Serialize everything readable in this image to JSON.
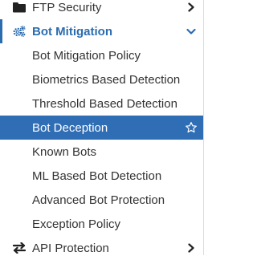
{
  "nav": {
    "ftp_security": {
      "label": "FTP Security",
      "icon": "folder-icon"
    },
    "bot_mitigation": {
      "label": "Bot Mitigation",
      "icon": "gears-icon",
      "items": [
        {
          "label": "Bot Mitigation Policy"
        },
        {
          "label": "Biometrics Based Detection"
        },
        {
          "label": "Threshold Based Detection"
        },
        {
          "label": "Bot Deception",
          "selected": true,
          "favorite_icon": "star-outline-icon"
        },
        {
          "label": "Known Bots"
        },
        {
          "label": "ML Based Bot Detection"
        },
        {
          "label": "Advanced Bot Protection"
        },
        {
          "label": "Exception Policy"
        }
      ]
    },
    "api_protection": {
      "label": "API Protection",
      "icon": "exchange-arrows-icon"
    }
  },
  "colors": {
    "accent": "#2b6cb0",
    "selected_bg": "#2f6db5",
    "text": "#333333",
    "icon": "#222222"
  }
}
